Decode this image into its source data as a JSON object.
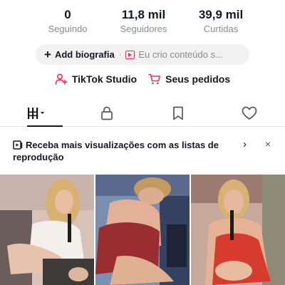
{
  "stats": [
    {
      "value": "0",
      "label": "Seguindo"
    },
    {
      "value": "11,8 mil",
      "label": "Seguidores"
    },
    {
      "value": "39,9 mil",
      "label": "Curtidas"
    }
  ],
  "bio": {
    "add_label": "Add biografia",
    "separator": "·",
    "hint": "Eu crio conteúdo s..."
  },
  "links": {
    "studio": "TikTok Studio",
    "orders": "Seus pedidos"
  },
  "tabs": [
    {
      "icon": "grid-icon",
      "active": true
    },
    {
      "icon": "lock-icon",
      "active": false
    },
    {
      "icon": "bookmark-icon",
      "active": false
    },
    {
      "icon": "heart-icon",
      "active": false
    }
  ],
  "banner": {
    "text": "Receba mais visualizações com as listas de reprodução",
    "chevron": "›",
    "close": "×"
  },
  "colors": {
    "accent": "#fe2c55",
    "text": "#161823",
    "muted": "#8a8b91",
    "pill": "#f1f1f2"
  },
  "videos": [
    {
      "icon": "video-thumbnail"
    },
    {
      "icon": "video-thumbnail"
    },
    {
      "icon": "video-thumbnail"
    }
  ]
}
